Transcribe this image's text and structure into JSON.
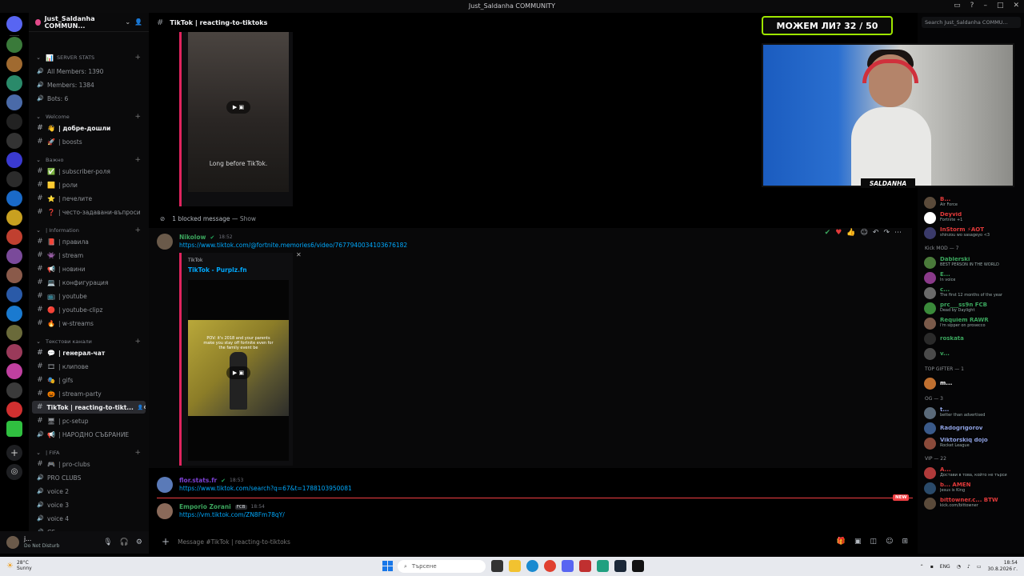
{
  "window": {
    "title": "Just_Saldanha COMMUNITY"
  },
  "guild": {
    "name": "Just_Saldanha COMMUN..."
  },
  "channels": [
    {
      "label": "SERVER STATS",
      "kind": "cat",
      "sym": "📊"
    },
    {
      "label": "All Members: 1390",
      "kind": "voice"
    },
    {
      "label": "Members: 1384",
      "kind": "voice"
    },
    {
      "label": "Bots: 6",
      "kind": "voice"
    },
    {
      "label": "Welcome",
      "kind": "cat"
    },
    {
      "label": "| добре-дошли",
      "kind": "bright",
      "sym": "👋"
    },
    {
      "label": "| boosts",
      "kind": "text",
      "sym": "🚀"
    },
    {
      "label": "Важно",
      "kind": "cat"
    },
    {
      "label": "| subscriber-роля",
      "kind": "text",
      "sym": "✅"
    },
    {
      "label": "| роли",
      "kind": "text",
      "sym": "🟨"
    },
    {
      "label": "| печелите",
      "kind": "text",
      "sym": "⭐"
    },
    {
      "label": "| често-задавани-въпроси",
      "kind": "text",
      "sym": "❓"
    },
    {
      "label": "| Information",
      "kind": "cat"
    },
    {
      "label": "| правила",
      "kind": "text",
      "sym": "📕"
    },
    {
      "label": "| stream",
      "kind": "text",
      "sym": "👾"
    },
    {
      "label": "| новини",
      "kind": "text",
      "sym": "📢"
    },
    {
      "label": "| конфигурация",
      "kind": "text",
      "sym": "💻"
    },
    {
      "label": "| youtube",
      "kind": "text",
      "sym": "📺"
    },
    {
      "label": "| youtube-clipz",
      "kind": "text",
      "sym": "🔴"
    },
    {
      "label": "| w-streams",
      "kind": "text",
      "sym": "🔥"
    },
    {
      "label": "Текстови канали",
      "kind": "cat"
    },
    {
      "label": "| генерал-чат",
      "kind": "bright",
      "sym": "💬"
    },
    {
      "label": "| клипове",
      "kind": "text",
      "sym": "🎞"
    },
    {
      "label": "| gifs",
      "kind": "text",
      "sym": "🎭"
    },
    {
      "label": "| stream-party",
      "kind": "text",
      "sym": "🎃"
    },
    {
      "label": "TikTok | reacting-to-tikt...",
      "kind": "active"
    },
    {
      "label": "| pc-setup",
      "kind": "text",
      "sym": "🖥"
    },
    {
      "label": "| НАРОДНО СЪБРАНИЕ",
      "kind": "voice-alt",
      "sym": "📢"
    },
    {
      "label": "| FIFA",
      "kind": "cat"
    },
    {
      "label": "| pro-clubs",
      "kind": "text",
      "sym": "🎮"
    },
    {
      "label": "PRO CLUBS",
      "kind": "voice"
    },
    {
      "label": "voice 2",
      "kind": "voice"
    },
    {
      "label": "voice 3",
      "kind": "voice"
    },
    {
      "label": "voice 4",
      "kind": "voice"
    },
    {
      "label": "CS",
      "kind": "voice"
    }
  ],
  "user": {
    "name": "j...",
    "status": "Do Not Disturb"
  },
  "chat": {
    "channel_title": "TikTok | reacting-to-tiktoks",
    "embed_top_caption": "Long before TikTok.",
    "blocked": {
      "text": "1 blocked message —",
      "show": "Show"
    },
    "messages": [
      {
        "author": "Nikolow",
        "ts": "18:52",
        "link": "https://www.tiktok.com/@fortnite.memories6/video/7677940034103676182",
        "color": "#3ba55d"
      },
      {
        "author": "flor.stats.fr",
        "ts": "18:53",
        "link": "https://www.tiktok.com/search?q=67&t=1788103950081",
        "color": "#7a3fd0"
      },
      {
        "author": "Emporio Zorani",
        "ts": "18:54",
        "tag": "FCB",
        "link": "https://vm.tiktok.com/ZN8Fm78qY/",
        "color": "#3ba55d"
      }
    ],
    "embed": {
      "provider": "TikTok",
      "title": "TikTok - Purplz.fn",
      "frame_text": "POV: it's 2018 and your parents make you stay off fortnite even for the family event be"
    },
    "new_badge": "NEW",
    "composer_placeholder": "Message #TikTok | reacting-to-tiktoks"
  },
  "search": {
    "placeholder": "Search Just_Saldanha COMMU..."
  },
  "overlay": {
    "counter": "МОЖЕМ ЛИ? 32 / 50",
    "cam_label": "SALDANHA"
  },
  "members": {
    "top": [
      {
        "name": "B...",
        "sub": "Air Force",
        "color": "#e23a3a"
      },
      {
        "name": "Deyvid",
        "sub": "Fortnite +1",
        "color": "#e23a3a"
      },
      {
        "name": "InStorm ⚡AOT",
        "sub": "shinzou wo sasageyo <3",
        "color": "#e23a3a"
      }
    ],
    "groups": [
      {
        "title": "Kick MOD — 7",
        "items": [
          {
            "name": "Dablerski",
            "sub": "BEST PERSON IN THE WORLD",
            "color": "#3ba55d"
          },
          {
            "name": "E...",
            "sub": "In voice",
            "color": "#3ba55d"
          },
          {
            "name": "c...",
            "sub": "The first 12 months of the year",
            "color": "#3ba55d"
          },
          {
            "name": "prc___ss9n FCB",
            "sub": "Dead by Daylight",
            "color": "#3ba55d"
          },
          {
            "name": "Requiem RAWR",
            "sub": "I'm sipper on prosecco",
            "color": "#3ba55d"
          },
          {
            "name": "roskata",
            "sub": "",
            "color": "#3ba55d"
          },
          {
            "name": "v...",
            "sub": "",
            "color": "#3ba55d"
          }
        ]
      },
      {
        "title": "TOP GIFTER — 1",
        "items": [
          {
            "name": "m...",
            "sub": "",
            "color": "#ffffff"
          }
        ]
      },
      {
        "title": "OG — 3",
        "items": [
          {
            "name": "t...",
            "sub": "better than advertised",
            "color": "#8ea1e1"
          },
          {
            "name": "Radogrigorov",
            "sub": "",
            "color": "#8ea1e1"
          },
          {
            "name": "Viktorskiq dojo",
            "sub": "Rocket League",
            "color": "#8ea1e1"
          }
        ]
      },
      {
        "title": "VIP — 22",
        "items": [
          {
            "name": "A...",
            "sub": "Достави в това, който не търси",
            "color": "#e23a3a"
          },
          {
            "name": "b... AMEN",
            "sub": "Jesus is King",
            "color": "#e23a3a"
          },
          {
            "name": "bittowner.c... BTW",
            "sub": "kick.com/bittowner",
            "color": "#e23a3a"
          }
        ]
      }
    ]
  },
  "taskbar": {
    "weather_temp": "28°C",
    "weather_desc": "Sunny",
    "search_label": "Търсене",
    "lang": "ENG",
    "time": "18:54",
    "date": "30.8.2026 г."
  }
}
